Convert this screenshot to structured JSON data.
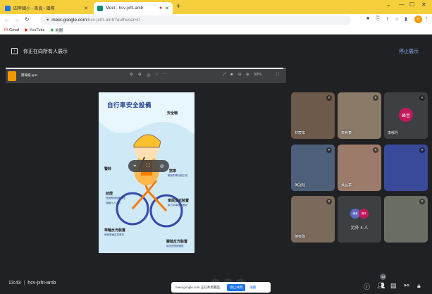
{
  "browser": {
    "tabs": [
      {
        "label": "四甲國小 - 首頁 - 國際",
        "active": false
      },
      {
        "label": "Meet - hcv-jxht-amb",
        "active": true
      }
    ],
    "new_tab_icon": "+",
    "url_host": "meet.google.com",
    "url_path": "/hcv-jxht-amb?authuser=0",
    "profile_initials": "H",
    "bookmarks": [
      {
        "icon": "gmail-icon",
        "label": "Gmail"
      },
      {
        "icon": "youtube-icon",
        "label": "YouTube"
      },
      {
        "icon": "maps-icon",
        "label": "地圖"
      }
    ]
  },
  "presenting_bar": {
    "text": "你正在向所有人展示",
    "stop_label": "停止展示"
  },
  "shared_screen": {
    "file_name": "簡報檔.pptx",
    "progress_fraction": 0.99,
    "zoom": "39%",
    "slide": {
      "title": "自行車安全設備",
      "labels": {
        "helmet": "安全帽",
        "bell": "警鈴",
        "brake": "煞車",
        "front_light": "前燈",
        "rear_reflector": "車尾反光裝置",
        "wheel_reflector": "車輪反光裝置",
        "pedal_reflector": "腳踏反光裝置"
      },
      "notes": {
        "bell": "提醒行人注意",
        "brake": "確保剎車功能正常",
        "front_light": "夜間照明視線清楚",
        "rear_reflector": "後方來車容易看見",
        "wheel_reflector": "側面車輛容易看見",
        "pedal_reflector": "增加夜間辨識度"
      }
    }
  },
  "participants": [
    {
      "name": "林宸佑",
      "muted": true
    },
    {
      "name": "李宥蓁",
      "muted": true
    },
    {
      "name": "李郁丹",
      "muted": true,
      "avatar_text": "峰音",
      "avatar_color": "#c2185b"
    },
    {
      "name": "陳冠廷",
      "muted": true
    },
    {
      "name": "黃品蓁",
      "muted": true
    },
    {
      "name": "",
      "muted": true
    },
    {
      "name": "陳宥融",
      "muted": true
    },
    {
      "name": "",
      "muted": false
    },
    {
      "name": "",
      "muted": true
    }
  ],
  "others_tile": {
    "label": "另外 4 人",
    "avatars": [
      "峰音",
      "鴻祥"
    ]
  },
  "bottom_bar": {
    "time": "13:43",
    "meeting_code": "hcv-jxht-amb",
    "people_count": "13",
    "share_banner_text": "meet.google.com 正在共用畫面。",
    "share_banner_stop": "停止共用",
    "share_banner_hide": "隱藏"
  },
  "colors": {
    "meet_bg": "#202124",
    "tab_strip": "#f6cf3c",
    "accent_blue": "#8ab4f8",
    "button_blue": "#1a73e8"
  }
}
